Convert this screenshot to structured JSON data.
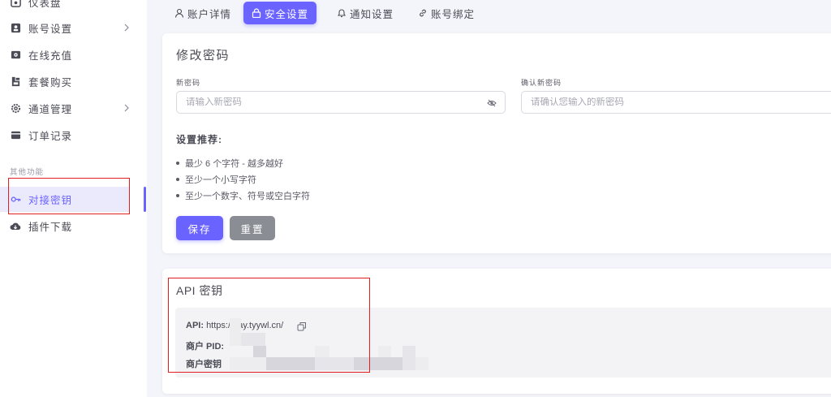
{
  "sidebar": {
    "items": [
      {
        "label": "仪表盘",
        "icon": "dashboard-icon"
      },
      {
        "label": "账号设置",
        "icon": "account-icon"
      },
      {
        "label": "在线充值",
        "icon": "recharge-icon"
      },
      {
        "label": "套餐购买",
        "icon": "package-icon"
      },
      {
        "label": "通道管理",
        "icon": "channel-gear-icon"
      },
      {
        "label": "订单记录",
        "icon": "order-icon"
      }
    ],
    "section_label": "其他功能",
    "other_items": [
      {
        "label": "对接密钥",
        "icon": "key-icon",
        "active": true
      },
      {
        "label": "插件下载",
        "icon": "cloud-download-icon"
      }
    ]
  },
  "tabs": [
    {
      "label": "账户详情",
      "icon": "user-icon"
    },
    {
      "label": "安全设置",
      "icon": "lock-icon",
      "active": true
    },
    {
      "label": "通知设置",
      "icon": "bell-icon"
    },
    {
      "label": "账号绑定",
      "icon": "link-icon"
    }
  ],
  "password_card": {
    "title": "修改密码",
    "new_password_label": "新密码",
    "new_password_placeholder": "请输入新密码",
    "confirm_password_label": "确认新密码",
    "confirm_password_placeholder": "请确认您输入的新密码",
    "recommend_title": "设置推荐:",
    "recommendations": [
      "最少 6 个字符 - 越多越好",
      "至少一个小写字符",
      "至少一个数字、符号或空白字符"
    ],
    "save_label": "保存",
    "reset_label": "重置"
  },
  "api_card": {
    "title": "API 密钥",
    "api_label": "API:",
    "api_value": "https://pay.tyywl.cn/",
    "pid_label": "商户 PID:",
    "key_label": "商户密钥"
  },
  "colors": {
    "accent": "#6b63ff",
    "reset_button": "#8a8d93",
    "annotation_red": "#e02020"
  }
}
